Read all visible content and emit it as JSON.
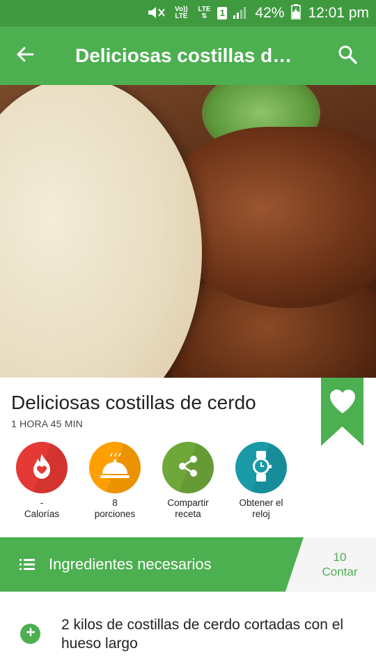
{
  "status_bar": {
    "volte": "Vo)) LTE",
    "lte": "LTE",
    "sim": "1",
    "battery": "42%",
    "time": "12:01 pm"
  },
  "app_bar": {
    "title": "Deliciosas costillas de cerdo",
    "back_icon": "arrow-back-icon",
    "search_icon": "search-icon"
  },
  "recipe": {
    "title": "Deliciosas costillas de cerdo",
    "time": "1 HORA 45 MIN"
  },
  "actions": [
    {
      "icon": "calories-icon",
      "value": "-",
      "label": "Calorías",
      "color": "#e53935"
    },
    {
      "icon": "servings-icon",
      "value": "8",
      "label": "porciones",
      "color": "#ff9f00"
    },
    {
      "icon": "share-icon",
      "value": "Compartir",
      "label": "receta",
      "color": "#6ea83a"
    },
    {
      "icon": "watch-icon",
      "value": "Obtener el",
      "label": "reloj",
      "color": "#1a9aa6"
    }
  ],
  "ingredients": {
    "header": "Ingredientes necesarios",
    "count": "10",
    "count_label": "Contar",
    "items": [
      {
        "text": "2 kilos de costillas de cerdo cortadas con el hueso largo"
      }
    ]
  },
  "colors": {
    "primary": "#4caf50",
    "primary_dark": "#3f9a3f"
  }
}
